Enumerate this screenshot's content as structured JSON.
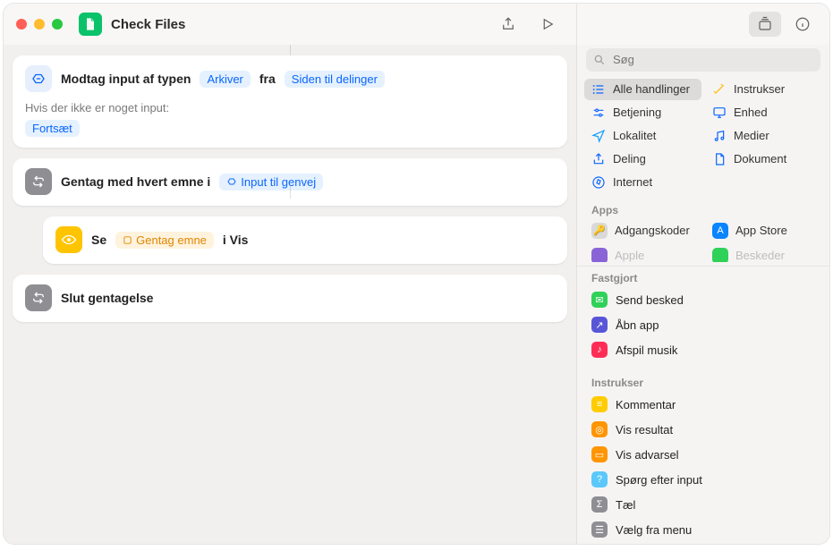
{
  "window": {
    "title": "Check Files"
  },
  "search": {
    "placeholder": "Søg"
  },
  "actions": {
    "receive": {
      "prefix": "Modtag input af typen",
      "type_token": "Arkiver",
      "from_word": "fra",
      "source_token": "Siden til delinger",
      "no_input_label": "Hvis der ikke er noget input:",
      "fallback_token": "Fortsæt"
    },
    "repeat": {
      "label": "Gentag med hvert emne i",
      "variable": "Input til genvej"
    },
    "see": {
      "label": "Se",
      "item_token": "Gentag emne",
      "in_word": "i Vis"
    },
    "end_repeat": {
      "label": "Slut gentagelse"
    }
  },
  "categories": [
    {
      "label": "Alle handlinger",
      "icon": "list",
      "color": "#0a66ff",
      "selected": true
    },
    {
      "label": "Instrukser",
      "icon": "wand",
      "color": "#ffba00"
    },
    {
      "label": "Betjening",
      "icon": "slider",
      "color": "#0a66ff"
    },
    {
      "label": "Enhed",
      "icon": "desktop",
      "color": "#0a66ff"
    },
    {
      "label": "Lokalitet",
      "icon": "nav",
      "color": "#0a9dff"
    },
    {
      "label": "Medier",
      "icon": "music",
      "color": "#0a66ff"
    },
    {
      "label": "Deling",
      "icon": "share",
      "color": "#0a66ff"
    },
    {
      "label": "Dokument",
      "icon": "doc",
      "color": "#0a66ff"
    },
    {
      "label": "Internet",
      "icon": "compass",
      "color": "#0a66ff"
    }
  ],
  "section_apps": "Apps",
  "apps": [
    {
      "label": "Adgangskoder",
      "color": "#d9d9d9",
      "glyph": "🔑"
    },
    {
      "label": "App Store",
      "color": "#0a84ff",
      "glyph": "A"
    },
    {
      "label": "Apple",
      "color": "#8a64d6",
      "glyph": "",
      "cutoff": true
    },
    {
      "label": "Beskeder",
      "color": "#30d158",
      "glyph": "",
      "cutoff": true
    }
  ],
  "section_pinned": "Fastgjort",
  "pinned": [
    {
      "label": "Send besked",
      "color": "#30d158",
      "glyph": "✉"
    },
    {
      "label": "Åbn app",
      "color": "#5856d6",
      "glyph": "↗"
    },
    {
      "label": "Afspil musik",
      "color": "#ff2d55",
      "glyph": "♪"
    }
  ],
  "section_scripts": "Instrukser",
  "scripts": [
    {
      "label": "Kommentar",
      "color": "#ffcc00",
      "glyph": "≡"
    },
    {
      "label": "Vis resultat",
      "color": "#ff9500",
      "glyph": "◎"
    },
    {
      "label": "Vis advarsel",
      "color": "#ff9500",
      "glyph": "▭"
    },
    {
      "label": "Spørg efter input",
      "color": "#5ac8fa",
      "glyph": "?"
    },
    {
      "label": "Tæl",
      "color": "#8e8e93",
      "glyph": "Σ"
    },
    {
      "label": "Vælg fra menu",
      "color": "#8e8e93",
      "glyph": "☰"
    }
  ]
}
